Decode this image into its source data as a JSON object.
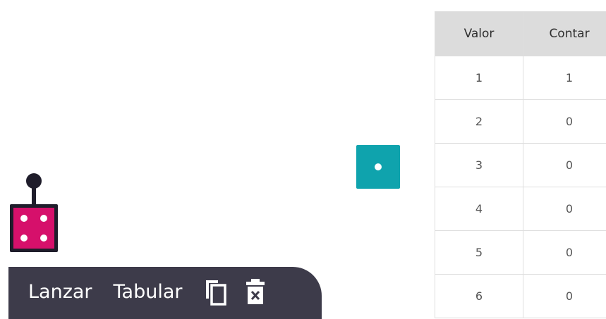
{
  "toolbar": {
    "roll_label": "Lanzar",
    "tabulate_label": "Tabular",
    "duplicate_icon": "copy-icon",
    "delete_icon": "delete-icon"
  },
  "die": {
    "face_value": 4,
    "color": "#d6106b"
  },
  "result_tile": {
    "face_value": 1,
    "color": "#0fa3ad"
  },
  "table": {
    "headers": [
      "Valor",
      "Contar"
    ],
    "rows": [
      [
        "1",
        "1"
      ],
      [
        "2",
        "0"
      ],
      [
        "3",
        "0"
      ],
      [
        "4",
        "0"
      ],
      [
        "5",
        "0"
      ],
      [
        "6",
        "0"
      ]
    ]
  }
}
